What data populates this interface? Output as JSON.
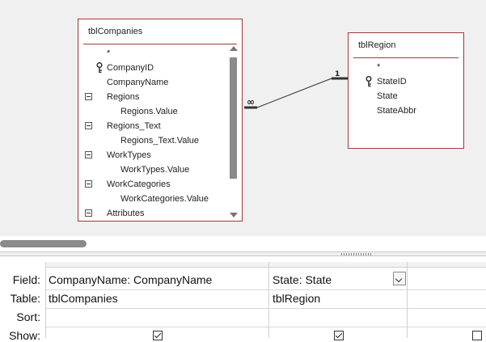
{
  "relationship_pane": {
    "tables": [
      {
        "title": "tblCompanies",
        "fields": [
          {
            "label": "*",
            "key": false,
            "expand": false,
            "indent": false
          },
          {
            "label": "CompanyID",
            "key": true,
            "expand": false,
            "indent": false
          },
          {
            "label": "CompanyName",
            "key": false,
            "expand": false,
            "indent": false
          },
          {
            "label": "Regions",
            "key": false,
            "expand": true,
            "indent": false
          },
          {
            "label": "Regions.Value",
            "key": false,
            "expand": false,
            "indent": true
          },
          {
            "label": "Regions_Text",
            "key": false,
            "expand": true,
            "indent": false
          },
          {
            "label": "Regions_Text.Value",
            "key": false,
            "expand": false,
            "indent": true
          },
          {
            "label": "WorkTypes",
            "key": false,
            "expand": true,
            "indent": false
          },
          {
            "label": "WorkTypes.Value",
            "key": false,
            "expand": false,
            "indent": true
          },
          {
            "label": "WorkCategories",
            "key": false,
            "expand": true,
            "indent": false
          },
          {
            "label": "WorkCategories.Value",
            "key": false,
            "expand": false,
            "indent": true
          },
          {
            "label": "Attributes",
            "key": false,
            "expand": true,
            "indent": false
          }
        ]
      },
      {
        "title": "tblRegion",
        "fields": [
          {
            "label": "*",
            "key": false,
            "expand": false,
            "indent": false
          },
          {
            "label": "StateID",
            "key": true,
            "expand": false,
            "indent": false
          },
          {
            "label": "State",
            "key": false,
            "expand": false,
            "indent": false
          },
          {
            "label": "StateAbbr",
            "key": false,
            "expand": false,
            "indent": false
          }
        ]
      }
    ],
    "relationship": {
      "many_symbol": "∞",
      "one_symbol": "1"
    }
  },
  "grid": {
    "row_labels": {
      "field": "Field:",
      "table": "Table:",
      "sort": "Sort:",
      "show": "Show:"
    },
    "columns": [
      {
        "field": "CompanyName: CompanyName",
        "table": "tblCompanies",
        "sort": "",
        "show": true
      },
      {
        "field": "State: State",
        "table": "tblRegion",
        "sort": "",
        "show": true
      },
      {
        "field": "",
        "table": "",
        "sort": "",
        "show": false
      }
    ]
  },
  "colors": {
    "table_border": "#a4373a",
    "pane_background": "#f0f0f0"
  }
}
